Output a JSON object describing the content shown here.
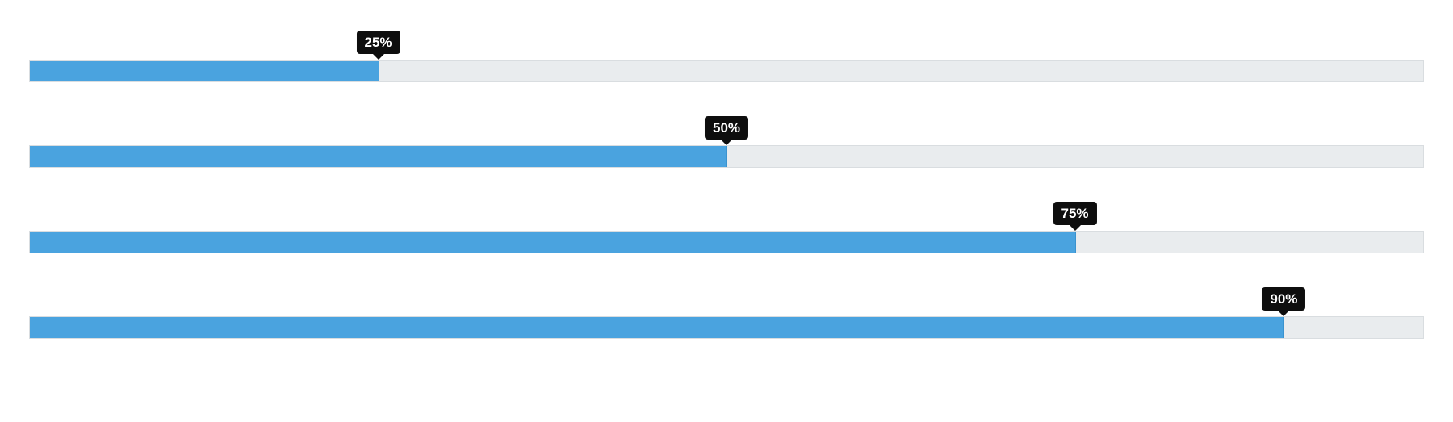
{
  "colors": {
    "fill": "#4aa3df",
    "track": "#e9ecee",
    "tooltip_bg": "#0e0e0e",
    "tooltip_fg": "#ffffff"
  },
  "bars": [
    {
      "percent": 25,
      "label": "25%"
    },
    {
      "percent": 50,
      "label": "50%"
    },
    {
      "percent": 75,
      "label": "75%"
    },
    {
      "percent": 90,
      "label": "90%"
    }
  ]
}
